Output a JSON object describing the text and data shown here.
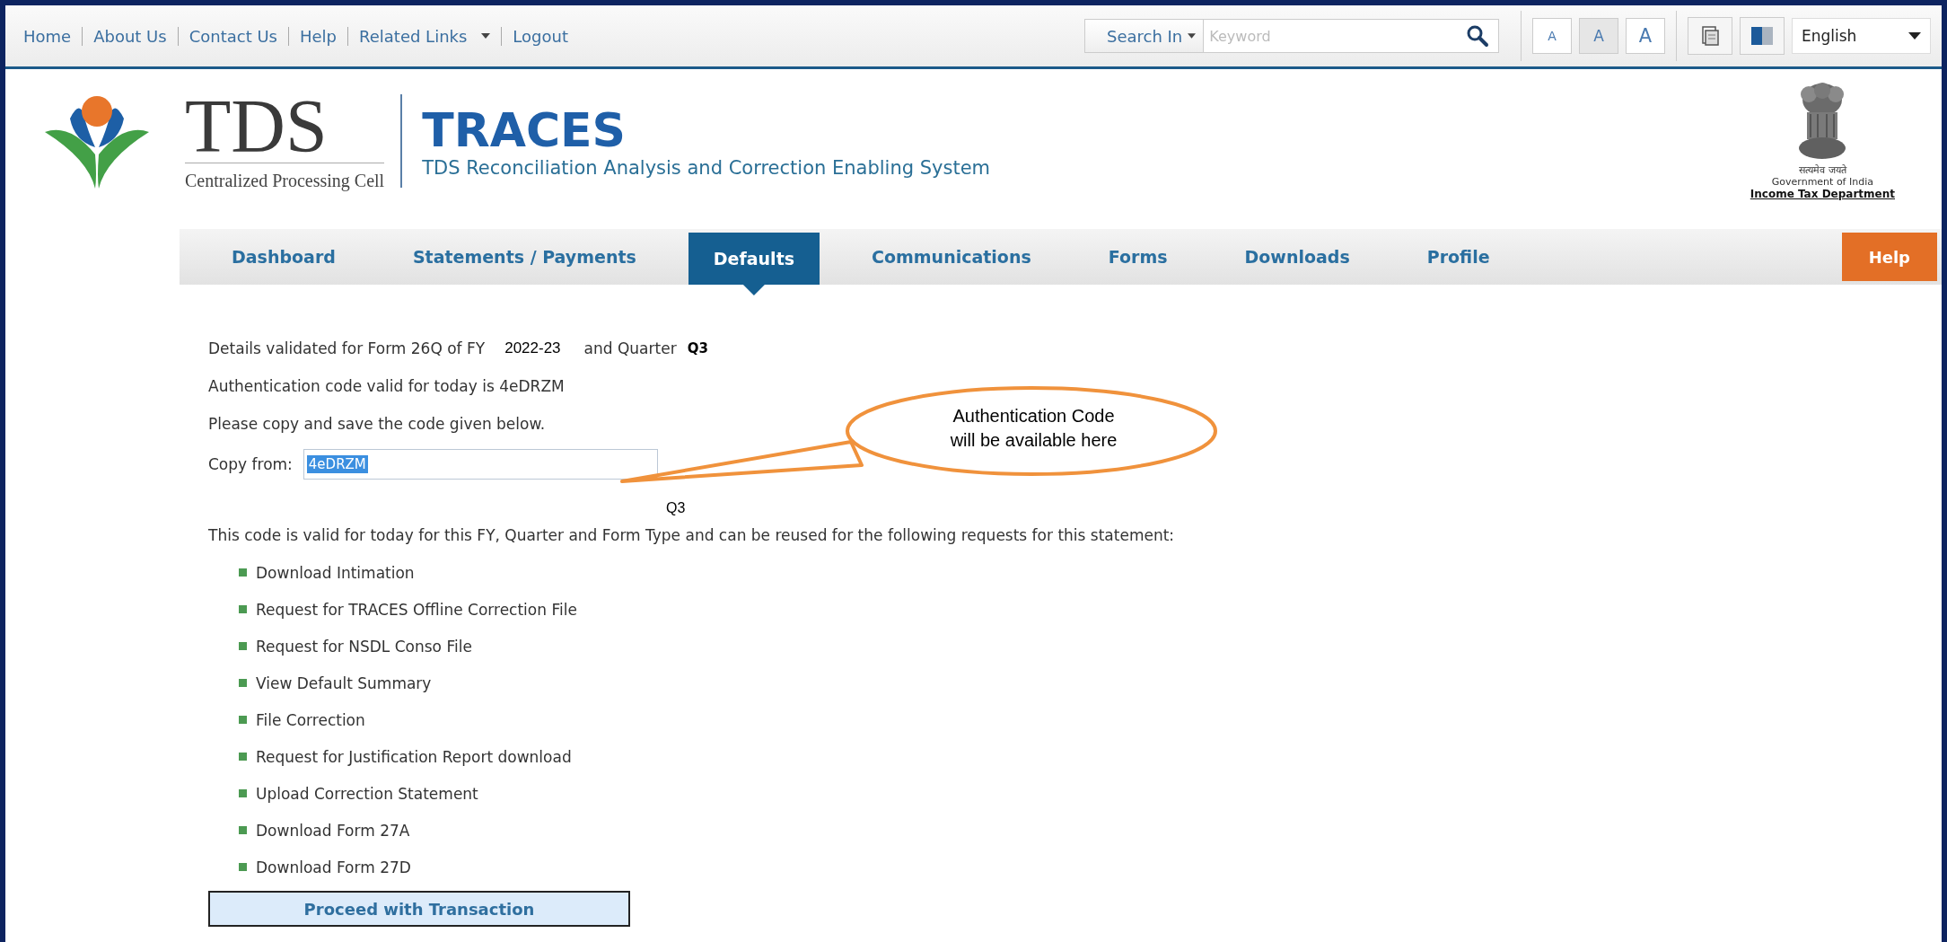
{
  "top_links": [
    {
      "label": "Home",
      "kind": "link"
    },
    {
      "label": "About Us",
      "kind": "link"
    },
    {
      "label": "Contact Us",
      "kind": "link"
    },
    {
      "label": "Help",
      "kind": "link"
    },
    {
      "label": "Related Links",
      "kind": "dropdown"
    },
    {
      "label": "Logout",
      "kind": "link"
    }
  ],
  "search": {
    "scope": "Search In",
    "placeholder": "Keyword"
  },
  "font_sizes": [
    {
      "label": "A",
      "selected": false
    },
    {
      "label": "A",
      "selected": true
    },
    {
      "label": "A",
      "selected": false
    }
  ],
  "language": "English",
  "brand": {
    "logo_text": "TDS",
    "logo_subtitle": "Centralized Processing Cell",
    "title": "TRACES",
    "subtitle": "TDS Reconciliation Analysis and Correction Enabling System"
  },
  "emblem": {
    "motto": "सत्यमेव जयते",
    "government": "Government of India",
    "department": "Income Tax Department"
  },
  "nav": [
    {
      "label": "Dashboard",
      "selected": false,
      "kind": "tab"
    },
    {
      "label": "Statements / Payments",
      "selected": false,
      "kind": "tab"
    },
    {
      "label": "Defaults",
      "selected": true,
      "kind": "tab"
    },
    {
      "label": "Communications",
      "selected": false,
      "kind": "tab"
    },
    {
      "label": "Forms",
      "selected": false,
      "kind": "tab"
    },
    {
      "label": "Downloads",
      "selected": false,
      "kind": "tab"
    },
    {
      "label": "Profile",
      "selected": false,
      "kind": "tab"
    },
    {
      "label": "Help",
      "selected": false,
      "kind": "help"
    }
  ],
  "content": {
    "details": {
      "text": "Details validated for Form 26Q of FY",
      "fy": "2022-23",
      "quarter_label": "and Quarter",
      "quarter": "Q3"
    },
    "auth_line": "Authentication code valid for today is 4eDRZM",
    "instruction": "Please copy and save the code given below.",
    "copy_label": "Copy from:",
    "copy_value": "4eDRZM",
    "floating_note": "Q3",
    "validity_note": "This code is valid for today for this FY, Quarter and Form Type and can be reused for the following requests for this statement:",
    "requests": [
      "Download Intimation",
      "Request for TRACES Offline Correction File",
      "Request for NSDL Conso File",
      "View Default Summary",
      "File Correction",
      "Request for Justification Report download",
      "Upload Correction Statement",
      "Download Form 27A",
      "Download Form 27D"
    ],
    "proceed_button": "Proceed with Transaction"
  },
  "callout": {
    "text": "Authentication Code will be available here"
  }
}
